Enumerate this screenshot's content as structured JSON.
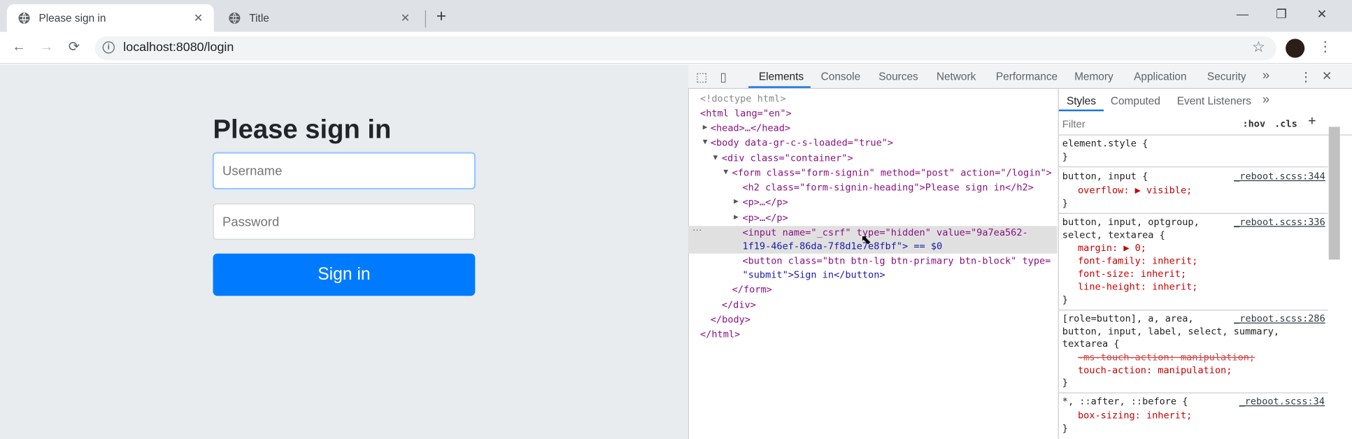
{
  "browser": {
    "tabs": [
      {
        "title": "Please sign in"
      },
      {
        "title": "Title"
      }
    ],
    "url": "localhost:8080/login"
  },
  "page": {
    "heading": "Please sign in",
    "username_placeholder": "Username",
    "password_placeholder": "Password",
    "signin_label": "Sign in"
  },
  "devtools": {
    "tabs": [
      "Elements",
      "Console",
      "Sources",
      "Network",
      "Performance",
      "Memory",
      "Application",
      "Security"
    ],
    "more": "»",
    "side_tabs": [
      "Styles",
      "Computed",
      "Event Listeners"
    ],
    "filter_placeholder": "Filter",
    "hov": ":hov",
    "cls": ".cls",
    "dom": {
      "doctype": "<!doctype html>",
      "html_open": "<html lang=\"en\">",
      "head": "<head>…</head>",
      "body_open": "<body data-gr-c-s-loaded=\"true\">",
      "div_open": "<div class=\"container\">",
      "form_open": "<form class=\"form-signin\" method=\"post\" action=\"/login\">",
      "h2": "<h2 class=\"form-signin-heading\">Please sign in</h2>",
      "p1": "<p>…</p>",
      "p2": "<p>…</p>",
      "input_line1": "<input name=\"_csrf\" type=\"hidden\" value=\"9a7ea562-",
      "input_line2": "1f19-46ef-86da-7f8d1e7e8fbf\"> == $0",
      "button_line1": "<button class=\"btn btn-lg btn-primary btn-block\" type=",
      "button_line2": "\"submit\">Sign in</button>",
      "form_close": "</form>",
      "div_close": "</div>",
      "body_close": "</body>",
      "html_close": "</html>"
    },
    "styles": [
      {
        "selector": "element.style {",
        "source": "",
        "props": [],
        "close": "}"
      },
      {
        "selector": "button, input {",
        "source": "_reboot.scss:344",
        "props": [
          "overflow: ▶ visible;"
        ],
        "close": "}"
      },
      {
        "selector": "button, input, optgroup,\nselect, textarea {",
        "source": "_reboot.scss:336",
        "props": [
          "margin: ▶ 0;",
          "font-family: inherit;",
          "font-size: inherit;",
          "line-height: inherit;"
        ],
        "close": "}"
      },
      {
        "selector": "[role=button], a, area,\nbutton, input, label, select, summary,\ntextarea {",
        "source": "_reboot.scss:286",
        "props": [
          "-ms-touch-action: manipulation;",
          "touch-action: manipulation;"
        ],
        "close": "}"
      },
      {
        "selector": "*, ::after, ::before {",
        "source": "_reboot.scss:34",
        "props": [
          "box-sizing: inherit;"
        ],
        "close": "}"
      }
    ]
  }
}
